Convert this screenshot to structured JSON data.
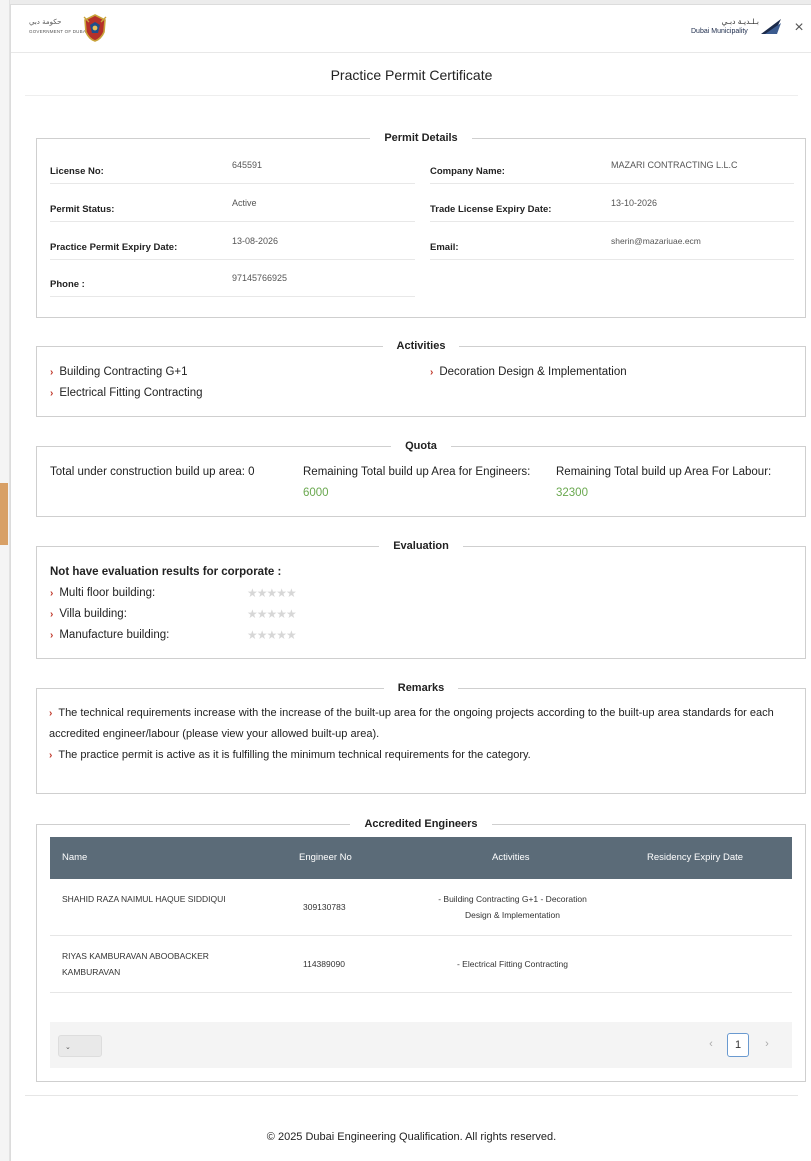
{
  "header": {
    "gov_logo_ar": "حكومة دبي",
    "gov_logo_en": "GOVERNMENT OF DUBAI",
    "dm_logo_ar": "بـلـديـة دبـي",
    "dm_logo_en": "Dubai Municipality",
    "close_label": "×"
  },
  "title": "Practice Permit Certificate",
  "permit_details": {
    "legend": "Permit Details",
    "license_no_label": "License No:",
    "license_no": "645591",
    "company_name_label": "Company Name:",
    "company_name": "MAZARI CONTRACTING L.L.C",
    "permit_status_label": "Permit Status:",
    "permit_status": "Active",
    "trade_license_expiry_label": "Trade License Expiry Date:",
    "trade_license_expiry": "13-10-2026",
    "practice_permit_expiry_label": "Practice Permit Expiry Date:",
    "practice_permit_expiry": "13-08-2026",
    "email_label": "Email:",
    "email": "sherin@mazariuae.ecm",
    "phone_label": "Phone :",
    "phone": "97145766925"
  },
  "activities": {
    "legend": "Activities",
    "items": [
      "Building Contracting G+1",
      "Decoration Design & Implementation",
      "Electrical Fitting Contracting"
    ]
  },
  "quota": {
    "legend": "Quota",
    "total_label": "Total under construction build up area: 0",
    "engineers_label": "Remaining Total build up Area for Engineers:",
    "engineers_value": "6000",
    "labour_label": "Remaining Total build up Area For Labour:",
    "labour_value": "32300",
    "value_color": "#6aa84f"
  },
  "evaluation": {
    "legend": "Evaluation",
    "heading": "Not have evaluation results for corporate :",
    "items": [
      {
        "label": "Multi floor building:",
        "rating": 0,
        "max": 5
      },
      {
        "label": "Villa building:",
        "rating": 0,
        "max": 5
      },
      {
        "label": "Manufacture building:",
        "rating": 0,
        "max": 5
      }
    ]
  },
  "remarks": {
    "legend": "Remarks",
    "items": [
      "The technical requirements increase with the increase of the built-up area for the ongoing projects according to the built-up area standards for each accredited engineer/labour (please view your allowed built-up area).",
      "The practice permit is active as it is fulfilling the minimum technical requirements for the category."
    ]
  },
  "engineers": {
    "legend": "Accredited Engineers",
    "columns": [
      "Name",
      "Engineer No",
      "Activities",
      "Residency Expiry Date"
    ],
    "rows": [
      {
        "name": "SHAHID RAZA NAIMUL HAQUE SIDDIQUI",
        "engineer_no": "309130783",
        "activities": "- Building Contracting G+1 - Decoration Design & Implementation",
        "residency_expiry": ""
      },
      {
        "name": "RIYAS KAMBURAVAN ABOOBACKER KAMBURAVAN",
        "engineer_no": "114389090",
        "activities": "- Electrical Fitting Contracting",
        "residency_expiry": ""
      }
    ],
    "page_size_value": "",
    "pagination": {
      "prev": "‹",
      "current": "1",
      "next": "›"
    },
    "header_color": "#5b6b78"
  },
  "footer": "© 2025 Dubai Engineering Qualification. All rights reserved.",
  "accent_color": "#c0392b"
}
